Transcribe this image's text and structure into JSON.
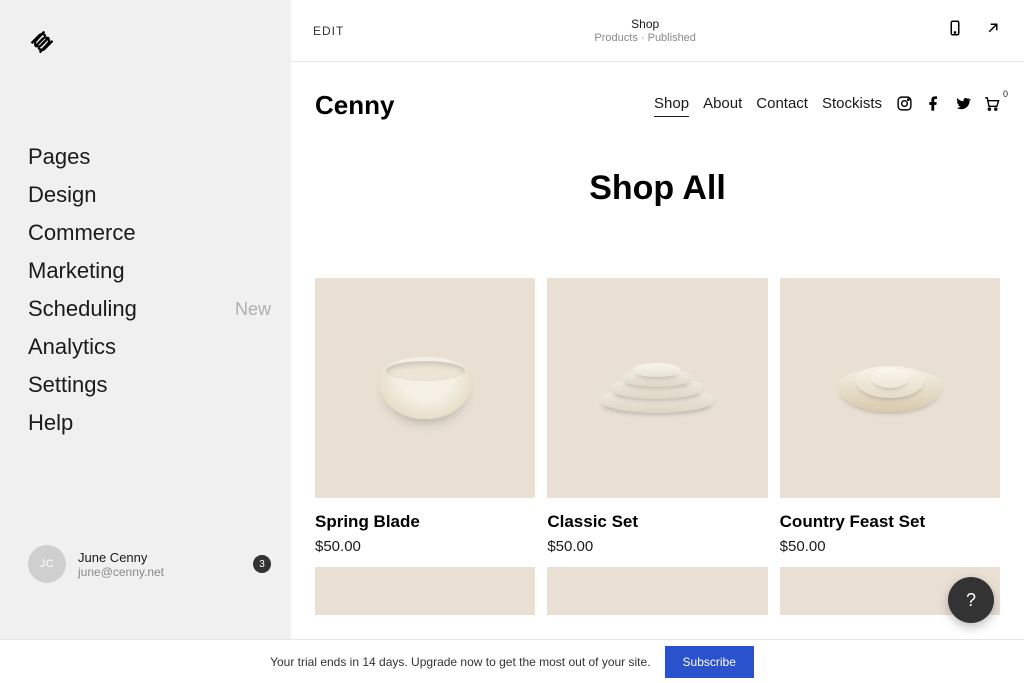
{
  "sidebar": {
    "nav": [
      {
        "label": "Pages",
        "tag": ""
      },
      {
        "label": "Design",
        "tag": ""
      },
      {
        "label": "Commerce",
        "tag": ""
      },
      {
        "label": "Marketing",
        "tag": ""
      },
      {
        "label": "Scheduling",
        "tag": "New"
      },
      {
        "label": "Analytics",
        "tag": ""
      },
      {
        "label": "Settings",
        "tag": ""
      },
      {
        "label": "Help",
        "tag": ""
      }
    ],
    "user": {
      "initials": "JC",
      "name": "June Cenny",
      "email": "june@cenny.net",
      "badge": "3"
    }
  },
  "preview_header": {
    "edit": "EDIT",
    "title": "Shop",
    "subtitle": "Products · Published"
  },
  "site": {
    "brand": "Cenny",
    "nav": [
      {
        "label": "Shop",
        "active": true
      },
      {
        "label": "About",
        "active": false
      },
      {
        "label": "Contact",
        "active": false
      },
      {
        "label": "Stockists",
        "active": false
      }
    ],
    "cart_count": "0",
    "page_title": "Shop All",
    "products": [
      {
        "name": "Spring Blade",
        "price": "$50.00"
      },
      {
        "name": "Classic Set",
        "price": "$50.00"
      },
      {
        "name": "Country Feast Set",
        "price": "$50.00"
      }
    ]
  },
  "help_label": "?",
  "trial": {
    "message": "Your trial ends in 14 days. Upgrade now to get the most out of your site.",
    "cta": "Subscribe"
  }
}
